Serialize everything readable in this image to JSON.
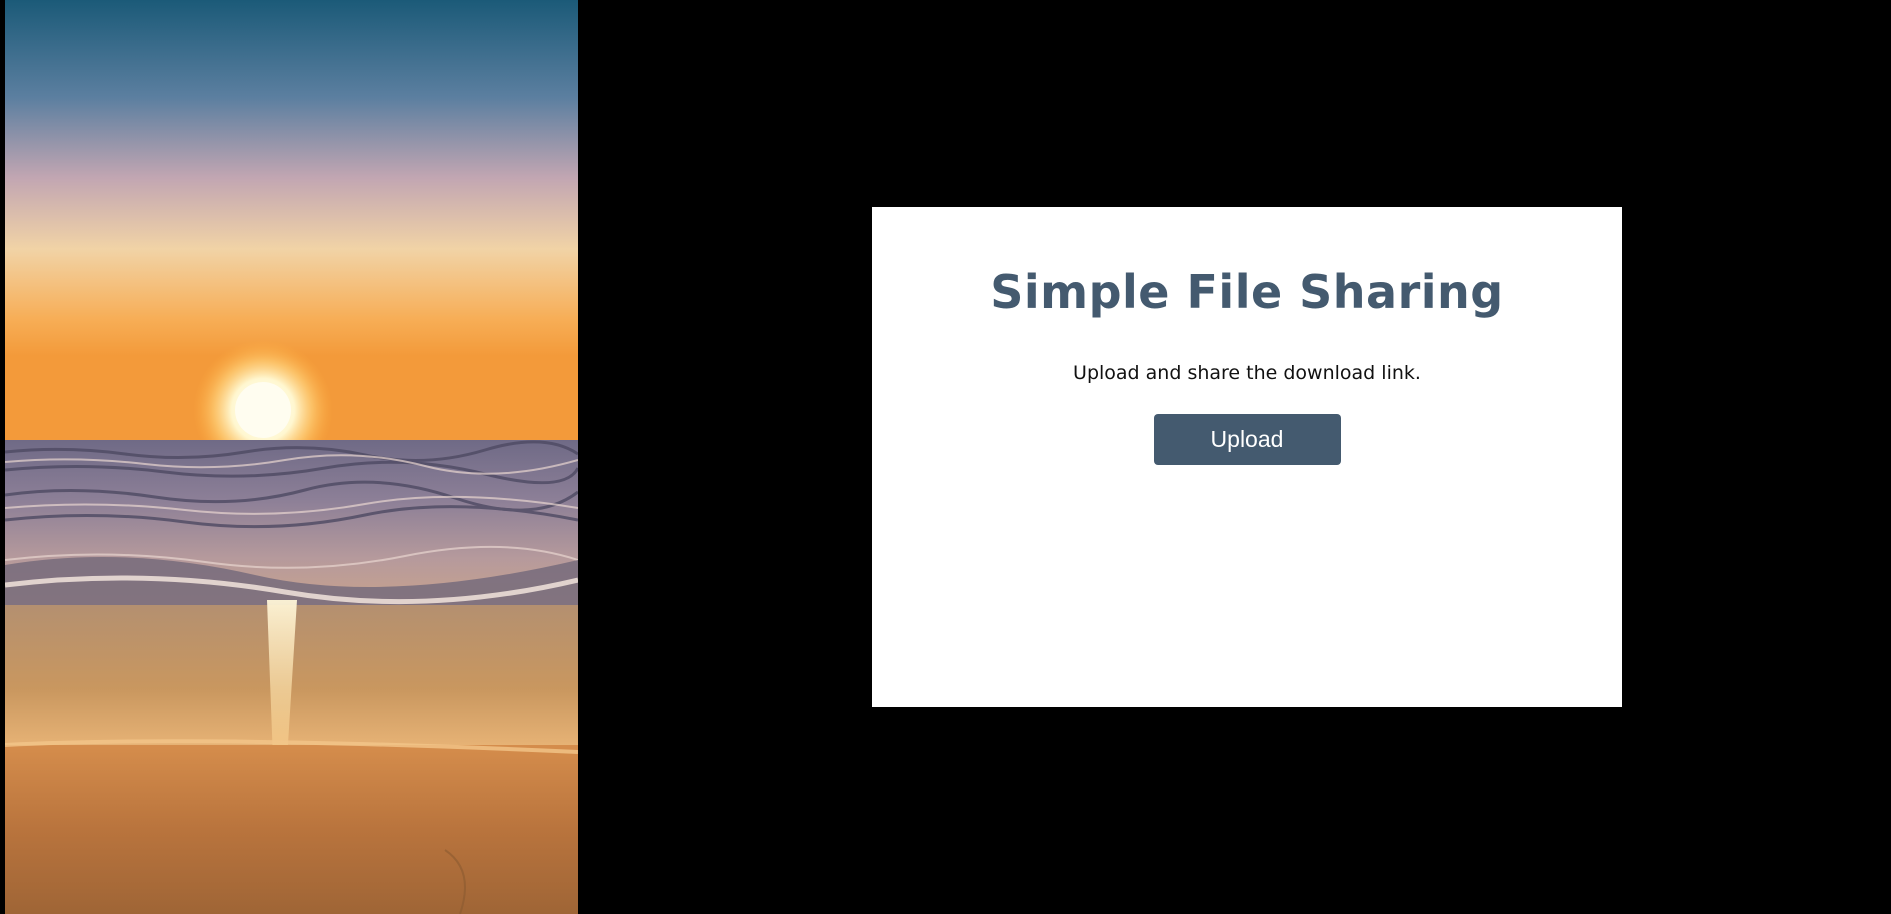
{
  "hero": {
    "image": "sunset-beach-photo"
  },
  "card": {
    "title": "Simple File Sharing",
    "subtitle": "Upload and share the download link.",
    "upload_label": "Upload"
  },
  "colors": {
    "background": "#000000",
    "card": "#ffffff",
    "accent": "#445a6f"
  }
}
